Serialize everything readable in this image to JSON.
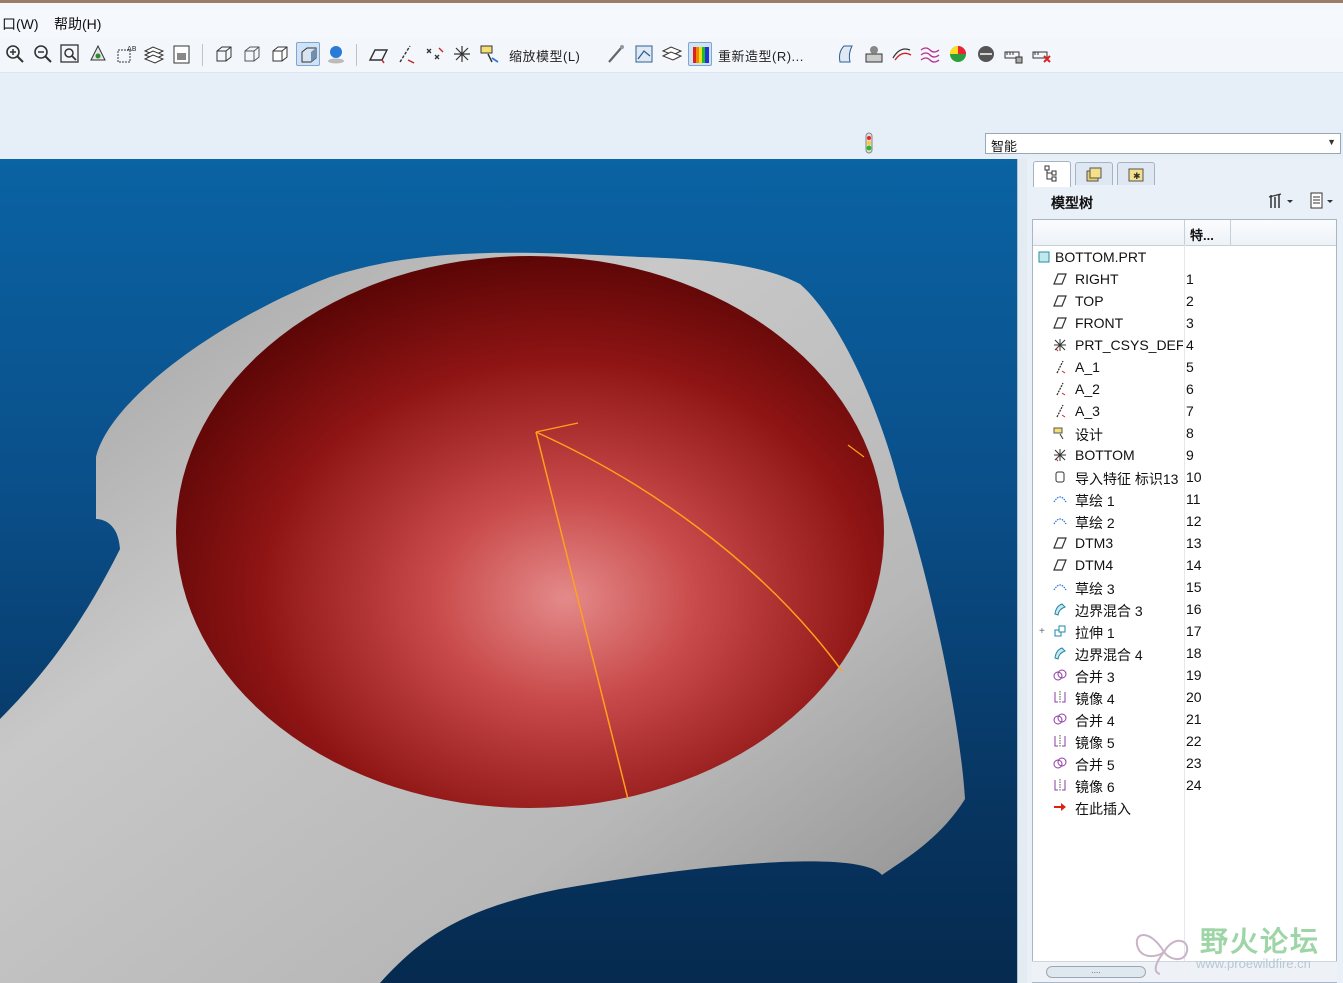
{
  "menu": {
    "window": "口(W)",
    "help": "帮助(H)"
  },
  "toolbar": {
    "zoom_model_label": "缩放模型(L)",
    "regenerate_label": "重新造型(R)..."
  },
  "filter": {
    "selected": "智能"
  },
  "model_tree": {
    "title": "模型树",
    "column_feature": "特...",
    "root": "BOTTOM.PRT",
    "items": [
      {
        "icon": "datum-plane-icon",
        "name": "RIGHT",
        "num": "1"
      },
      {
        "icon": "datum-plane-icon",
        "name": "TOP",
        "num": "2"
      },
      {
        "icon": "datum-plane-icon",
        "name": "FRONT",
        "num": "3"
      },
      {
        "icon": "coordinate-system-icon",
        "name": "PRT_CSYS_DEF",
        "num": "4"
      },
      {
        "icon": "datum-axis-icon",
        "name": "A_1",
        "num": "5"
      },
      {
        "icon": "datum-axis-icon",
        "name": "A_2",
        "num": "6"
      },
      {
        "icon": "datum-axis-icon",
        "name": "A_3",
        "num": "7"
      },
      {
        "icon": "annotation-icon",
        "name": "设计",
        "num": "8"
      },
      {
        "icon": "coordinate-system-icon",
        "name": "BOTTOM",
        "num": "9"
      },
      {
        "icon": "import-feature-icon",
        "name": "导入特征 标识13",
        "num": "10"
      },
      {
        "icon": "sketch-icon",
        "name": "草绘 1",
        "num": "11"
      },
      {
        "icon": "sketch-icon",
        "name": "草绘 2",
        "num": "12"
      },
      {
        "icon": "datum-plane-icon",
        "name": "DTM3",
        "num": "13"
      },
      {
        "icon": "datum-plane-icon",
        "name": "DTM4",
        "num": "14"
      },
      {
        "icon": "sketch-icon",
        "name": "草绘 3",
        "num": "15"
      },
      {
        "icon": "boundary-blend-icon",
        "name": "边界混合 3",
        "num": "16"
      },
      {
        "icon": "extrude-icon",
        "name": "拉伸 1",
        "num": "17"
      },
      {
        "icon": "boundary-blend-icon",
        "name": "边界混合 4",
        "num": "18"
      },
      {
        "icon": "merge-icon",
        "name": "合并 3",
        "num": "19"
      },
      {
        "icon": "mirror-icon",
        "name": "镜像 4",
        "num": "20"
      },
      {
        "icon": "merge-icon",
        "name": "合并 4",
        "num": "21"
      },
      {
        "icon": "mirror-icon",
        "name": "镜像 5",
        "num": "22"
      },
      {
        "icon": "merge-icon",
        "name": "合并 5",
        "num": "23"
      },
      {
        "icon": "mirror-icon",
        "name": "镜像 6",
        "num": "24"
      }
    ],
    "insert_here": "在此插入"
  },
  "watermark": {
    "title": "野火论坛",
    "url": "www.proewildfire.cn"
  },
  "colors": {
    "viewport_top": "#0a63a3",
    "viewport_bottom": "#062a4f",
    "surface_red": "#8e1414",
    "surface_gray": "#b8b8b8",
    "curve_orange": "#ffa21a"
  }
}
